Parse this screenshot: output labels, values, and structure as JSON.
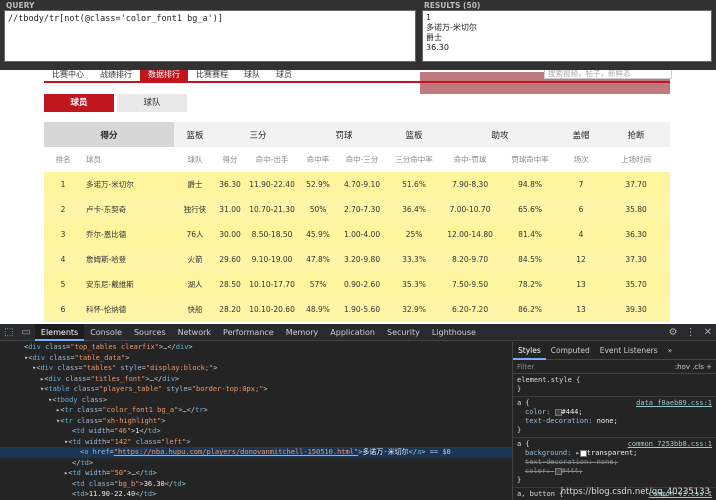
{
  "xpath": {
    "query_label": "QUERY",
    "results_label": "RESULTS (50)",
    "query": "//tbody/tr[not(@class='color_font1 bg_a')]",
    "results": [
      "1",
      "多诺万-米切尔",
      "爵士",
      "36.30"
    ]
  },
  "nav": {
    "tabs": [
      "比赛中心",
      "战绩排行",
      "数据排行",
      "比赛赛程",
      "球队",
      "球员"
    ],
    "active": 2,
    "search_placeholder": "搜索视频，帖子，新鲜态"
  },
  "toggle": {
    "players": "球员",
    "teams": "球队"
  },
  "categories": [
    "得分",
    "篮板",
    "三分",
    "罚球",
    "篮板",
    "助攻",
    "盖帽",
    "抢断"
  ],
  "headers": [
    "排名",
    "球员",
    "球队",
    "得分",
    "命中-出手",
    "命中率",
    "命中-三分",
    "三分命中率",
    "命中-罚球",
    "罚球命中率",
    "场次",
    "上场时间"
  ],
  "rows": [
    [
      "1",
      "多诺万-米切尔",
      "爵士",
      "36.30",
      "11.90-22.40",
      "52.9%",
      "4.70-9.10",
      "51.6%",
      "7.90-8.30",
      "94.8%",
      "7",
      "37.70"
    ],
    [
      "2",
      "卢卡-东契奇",
      "独行侠",
      "31.00",
      "10.70-21.30",
      "50%",
      "2.70-7.30",
      "36.4%",
      "7.00-10.70",
      "65.6%",
      "6",
      "35.80"
    ],
    [
      "3",
      "乔尔-恩比德",
      "76人",
      "30.00",
      "8.50-18.50",
      "45.9%",
      "1.00-4.00",
      "25%",
      "12.00-14.80",
      "81.4%",
      "4",
      "36.30"
    ],
    [
      "4",
      "詹姆斯-哈登",
      "火箭",
      "29.60",
      "9.10-19.00",
      "47.8%",
      "3.20-9.80",
      "33.3%",
      "8.20-9.70",
      "84.5%",
      "12",
      "37.30"
    ],
    [
      "5",
      "安东尼-戴维斯",
      "湖人",
      "28.50",
      "10.10-17.70",
      "57%",
      "0.90-2.60",
      "35.3%",
      "7.50-9.50",
      "78.2%",
      "13",
      "35.70"
    ],
    [
      "6",
      "科怀-伦纳德",
      "快船",
      "28.20",
      "10.10-20.60",
      "48.9%",
      "1.90-5.60",
      "32.9%",
      "6.20-7.20",
      "86.2%",
      "13",
      "39.30"
    ]
  ],
  "devtools": {
    "tabs": [
      "Elements",
      "Console",
      "Sources",
      "Network",
      "Performance",
      "Memory",
      "Application",
      "Security",
      "Lighthouse"
    ],
    "active": 0
  },
  "dom": [
    {
      "i": 2,
      "h": "&lt;<span class='tg'>div</span> <span class='at'>class</span>=<span class='av'>\"top_tables clearfix\"</span>&gt;…&lt;/<span class='tg'>div</span>&gt;"
    },
    {
      "i": 2,
      "h": "▾&lt;<span class='tg'>div</span> <span class='at'>class</span>=<span class='av'>\"table_data\"</span>&gt;"
    },
    {
      "i": 4,
      "h": "▾&lt;<span class='tg'>div</span> <span class='at'>class</span>=<span class='av'>\"tables\"</span> <span class='at'>style</span>=<span class='av'>\"display:block;\"</span>&gt;"
    },
    {
      "i": 6,
      "h": "▸&lt;<span class='tg'>div</span> <span class='at'>class</span>=<span class='av'>\"titles_font\"</span>&gt;…&lt;/<span class='tg'>div</span>&gt;"
    },
    {
      "i": 6,
      "h": "▾&lt;<span class='tg'>table</span> <span class='at'>class</span>=<span class='av'>\"players_table\"</span> <span class='at'>style</span>=<span class='av'>\"border-top:0px;\"</span>&gt;"
    },
    {
      "i": 8,
      "h": "▾&lt;<span class='tg'>tbody</span> <span class='at'>class</span>&gt;"
    },
    {
      "i": 10,
      "h": "▸&lt;<span class='tg'>tr</span> <span class='at'>class</span>=<span class='av'>\"color_font1 bg_a\"</span>&gt;…&lt;/<span class='tg'>tr</span>&gt;"
    },
    {
      "i": 10,
      "h": "▾&lt;<span class='tg'>tr</span> <span class='at'>class</span>=<span class='av'>\"xh-highlight\"</span>&gt;"
    },
    {
      "i": 14,
      "h": "&lt;<span class='tg'>td</span> <span class='at'>width</span>=<span class='av'>\"46\"</span>&gt;<span class='tx'>1</span>&lt;/<span class='tg'>td</span>&gt;"
    },
    {
      "i": 12,
      "h": "▾&lt;<span class='tg'>td</span> <span class='at'>width</span>=<span class='av'>\"142\"</span> <span class='at'>class</span>=<span class='av'>\"left\"</span>&gt;"
    },
    {
      "i": 16,
      "hl": true,
      "h": "&lt;<span class='tg'>a</span> <span class='at'>href</span>=<span class='av' style='text-decoration:underline'>\"https://nba.hupu.com/players/donovanmitchell-150510.html\"</span>&gt;<span class='tx'>多诺万-米切尔</span>&lt;/<span class='tg'>a</span>&gt; == $0"
    },
    {
      "i": 14,
      "h": "&lt;/<span class='tg'>td</span>&gt;"
    },
    {
      "i": 12,
      "h": "▸&lt;<span class='tg'>td</span> <span class='at'>width</span>=<span class='av'>\"50\"</span>&gt;…&lt;/<span class='tg'>td</span>&gt;"
    },
    {
      "i": 14,
      "h": "&lt;<span class='tg'>td</span> <span class='at'>class</span>=<span class='av'>\"bg_b\"</span>&gt;<span class='tx'>36.30</span>&lt;/<span class='tg'>td</span>&gt;"
    },
    {
      "i": 14,
      "h": "&lt;<span class='tg'>td</span>&gt;<span class='tx'>11.90-22.40</span>&lt;/<span class='tg'>td</span>&gt;"
    }
  ],
  "styles": {
    "tabs": [
      "Styles",
      "Computed",
      "Event Listeners"
    ],
    "filter": "Filter",
    "hov": ":hov .cls",
    "element_style": "element.style {",
    "close": "}",
    "rule1_sel": "a {",
    "rule1_src": "data_f0aeb89.css:1",
    "rule1_p1": "color:",
    "rule1_v1": "#444;",
    "rule1_p2": "text-decoration:",
    "rule1_v2": "none;",
    "rule2_sel": "a {",
    "rule2_src": "common_7253bb8.css:1",
    "rule2_p1": "background:",
    "rule2_v1": "transparent;",
    "rule2_p2": "text-decoration:",
    "rule2_v2": "none;",
    "rule2_p3": "color:",
    "rule2_v3": "#444;",
    "rule3_sel": "a, button {",
    "rule3_src": "common-v3.css:1"
  },
  "watermark": "https://blog.csdn.net/qq_40235133"
}
